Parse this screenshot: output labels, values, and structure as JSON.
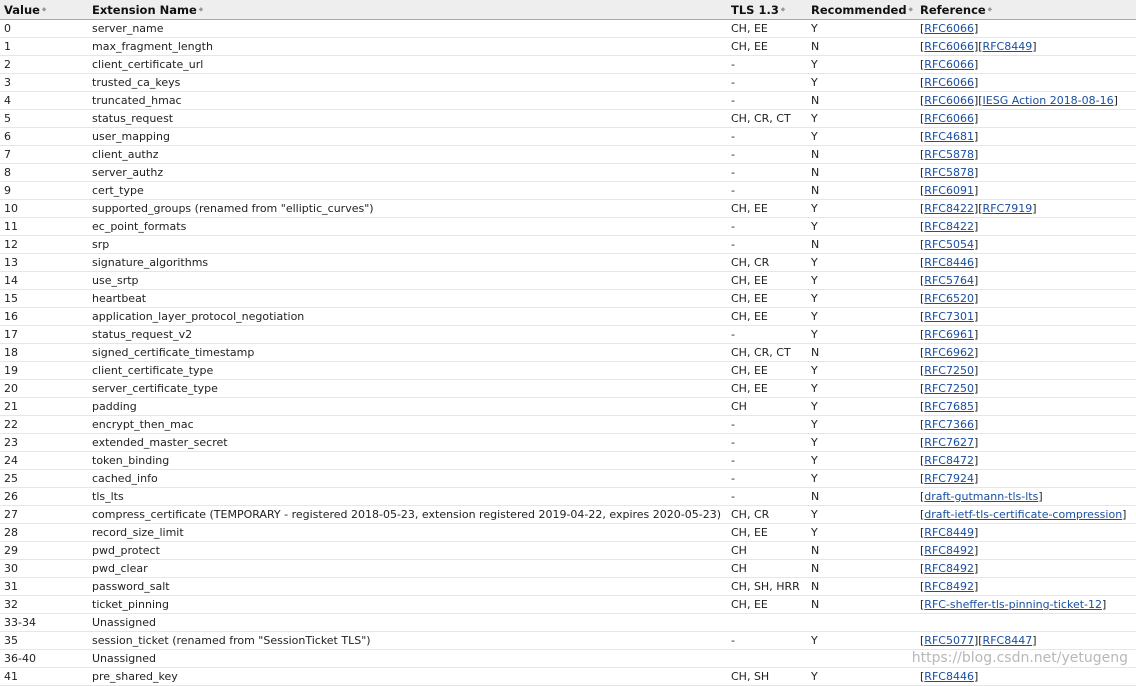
{
  "headers": {
    "value": "Value",
    "name": "Extension Name",
    "tls13": "TLS 1.3",
    "recommended": "Recommended",
    "reference": "Reference"
  },
  "sort_icon": "⬥",
  "rows": [
    {
      "value": "0",
      "name": "server_name",
      "tls13": "CH, EE",
      "rec": "Y",
      "refs": [
        "RFC6066"
      ]
    },
    {
      "value": "1",
      "name": "max_fragment_length",
      "tls13": "CH, EE",
      "rec": "N",
      "refs": [
        "RFC6066",
        "RFC8449"
      ]
    },
    {
      "value": "2",
      "name": "client_certificate_url",
      "tls13": "-",
      "rec": "Y",
      "refs": [
        "RFC6066"
      ]
    },
    {
      "value": "3",
      "name": "trusted_ca_keys",
      "tls13": "-",
      "rec": "Y",
      "refs": [
        "RFC6066"
      ]
    },
    {
      "value": "4",
      "name": "truncated_hmac",
      "tls13": "-",
      "rec": "N",
      "refs": [
        "RFC6066",
        "IESG Action 2018-08-16"
      ]
    },
    {
      "value": "5",
      "name": "status_request",
      "tls13": "CH, CR, CT",
      "rec": "Y",
      "refs": [
        "RFC6066"
      ]
    },
    {
      "value": "6",
      "name": "user_mapping",
      "tls13": "-",
      "rec": "Y",
      "refs": [
        "RFC4681"
      ]
    },
    {
      "value": "7",
      "name": "client_authz",
      "tls13": "-",
      "rec": "N",
      "refs": [
        "RFC5878"
      ]
    },
    {
      "value": "8",
      "name": "server_authz",
      "tls13": "-",
      "rec": "N",
      "refs": [
        "RFC5878"
      ]
    },
    {
      "value": "9",
      "name": "cert_type",
      "tls13": "-",
      "rec": "N",
      "refs": [
        "RFC6091"
      ]
    },
    {
      "value": "10",
      "name": "supported_groups (renamed from \"elliptic_curves\")",
      "tls13": "CH, EE",
      "rec": "Y",
      "refs": [
        "RFC8422",
        "RFC7919"
      ]
    },
    {
      "value": "11",
      "name": "ec_point_formats",
      "tls13": "-",
      "rec": "Y",
      "refs": [
        "RFC8422"
      ]
    },
    {
      "value": "12",
      "name": "srp",
      "tls13": "-",
      "rec": "N",
      "refs": [
        "RFC5054"
      ]
    },
    {
      "value": "13",
      "name": "signature_algorithms",
      "tls13": "CH, CR",
      "rec": "Y",
      "refs": [
        "RFC8446"
      ]
    },
    {
      "value": "14",
      "name": "use_srtp",
      "tls13": "CH, EE",
      "rec": "Y",
      "refs": [
        "RFC5764"
      ]
    },
    {
      "value": "15",
      "name": "heartbeat",
      "tls13": "CH, EE",
      "rec": "Y",
      "refs": [
        "RFC6520"
      ]
    },
    {
      "value": "16",
      "name": "application_layer_protocol_negotiation",
      "tls13": "CH, EE",
      "rec": "Y",
      "refs": [
        "RFC7301"
      ]
    },
    {
      "value": "17",
      "name": "status_request_v2",
      "tls13": "-",
      "rec": "Y",
      "refs": [
        "RFC6961"
      ]
    },
    {
      "value": "18",
      "name": "signed_certificate_timestamp",
      "tls13": "CH, CR, CT",
      "rec": "N",
      "refs": [
        "RFC6962"
      ]
    },
    {
      "value": "19",
      "name": "client_certificate_type",
      "tls13": "CH, EE",
      "rec": "Y",
      "refs": [
        "RFC7250"
      ]
    },
    {
      "value": "20",
      "name": "server_certificate_type",
      "tls13": "CH, EE",
      "rec": "Y",
      "refs": [
        "RFC7250"
      ]
    },
    {
      "value": "21",
      "name": "padding",
      "tls13": "CH",
      "rec": "Y",
      "refs": [
        "RFC7685"
      ]
    },
    {
      "value": "22",
      "name": "encrypt_then_mac",
      "tls13": "-",
      "rec": "Y",
      "refs": [
        "RFC7366"
      ]
    },
    {
      "value": "23",
      "name": "extended_master_secret",
      "tls13": "-",
      "rec": "Y",
      "refs": [
        "RFC7627"
      ]
    },
    {
      "value": "24",
      "name": "token_binding",
      "tls13": "-",
      "rec": "Y",
      "refs": [
        "RFC8472"
      ]
    },
    {
      "value": "25",
      "name": "cached_info",
      "tls13": "-",
      "rec": "Y",
      "refs": [
        "RFC7924"
      ]
    },
    {
      "value": "26",
      "name": "tls_lts",
      "tls13": "-",
      "rec": "N",
      "refs": [
        "draft-gutmann-tls-lts"
      ]
    },
    {
      "value": "27",
      "name": "compress_certificate (TEMPORARY - registered 2018-05-23, extension registered 2019-04-22, expires 2020-05-23)",
      "tls13": "CH, CR",
      "rec": "Y",
      "refs": [
        "draft-ietf-tls-certificate-compression"
      ]
    },
    {
      "value": "28",
      "name": "record_size_limit",
      "tls13": "CH, EE",
      "rec": "Y",
      "refs": [
        "RFC8449"
      ]
    },
    {
      "value": "29",
      "name": "pwd_protect",
      "tls13": "CH",
      "rec": "N",
      "refs": [
        "RFC8492"
      ]
    },
    {
      "value": "30",
      "name": "pwd_clear",
      "tls13": "CH",
      "rec": "N",
      "refs": [
        "RFC8492"
      ]
    },
    {
      "value": "31",
      "name": "password_salt",
      "tls13": "CH, SH, HRR",
      "rec": "N",
      "refs": [
        "RFC8492"
      ]
    },
    {
      "value": "32",
      "name": "ticket_pinning",
      "tls13": "CH, EE",
      "rec": "N",
      "refs": [
        "RFC-sheffer-tls-pinning-ticket-12"
      ]
    },
    {
      "value": "33-34",
      "name": "Unassigned",
      "tls13": "",
      "rec": "",
      "refs": []
    },
    {
      "value": "35",
      "name": "session_ticket (renamed from \"SessionTicket TLS\")",
      "tls13": "-",
      "rec": "Y",
      "refs": [
        "RFC5077",
        "RFC8447"
      ]
    },
    {
      "value": "36-40",
      "name": "Unassigned",
      "tls13": "",
      "rec": "",
      "refs": []
    },
    {
      "value": "41",
      "name": "pre_shared_key",
      "tls13": "CH, SH",
      "rec": "Y",
      "refs": [
        "RFC8446"
      ]
    }
  ],
  "watermark": "https://blog.csdn.net/yetugeng"
}
